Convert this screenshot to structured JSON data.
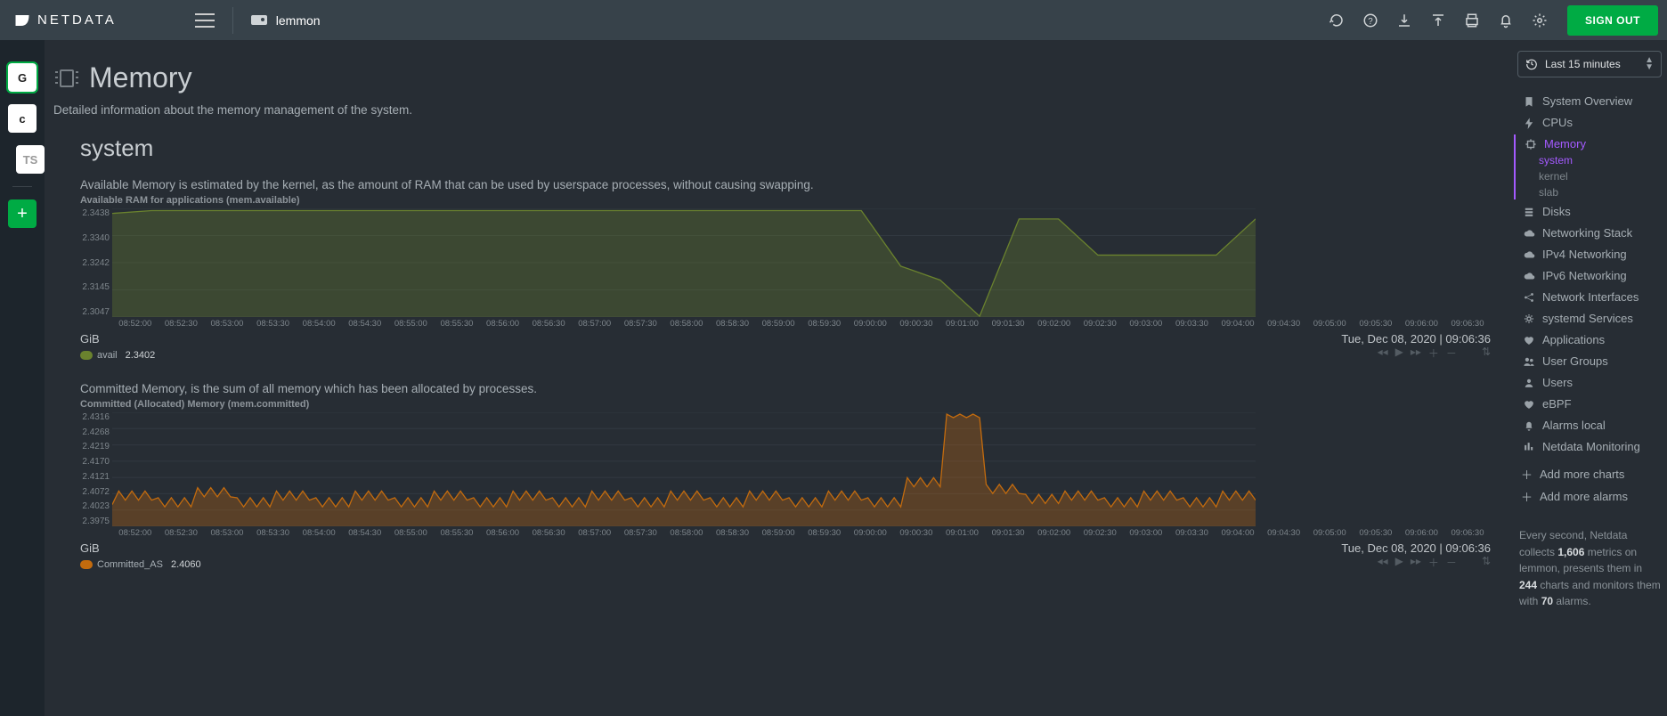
{
  "brand": "NETDATA",
  "host": "lemmon",
  "signout": "SIGN OUT",
  "rail": [
    "G",
    "c",
    "TS"
  ],
  "timerange": "Last 15 minutes",
  "page": {
    "title": "Memory",
    "subtitle": "Detailed information about the memory management of the system.",
    "section": "system"
  },
  "sidebar": {
    "items": [
      {
        "icon": "bookmark",
        "label": "System Overview"
      },
      {
        "icon": "bolt",
        "label": "CPUs"
      },
      {
        "icon": "chip",
        "label": "Memory",
        "active": true,
        "children": [
          {
            "label": "system",
            "active": true
          },
          {
            "label": "kernel"
          },
          {
            "label": "slab"
          }
        ]
      },
      {
        "icon": "disk",
        "label": "Disks"
      },
      {
        "icon": "cloud",
        "label": "Networking Stack"
      },
      {
        "icon": "cloud",
        "label": "IPv4 Networking"
      },
      {
        "icon": "cloud",
        "label": "IPv6 Networking"
      },
      {
        "icon": "share",
        "label": "Network Interfaces"
      },
      {
        "icon": "gears",
        "label": "systemd Services"
      },
      {
        "icon": "heart",
        "label": "Applications"
      },
      {
        "icon": "users",
        "label": "User Groups"
      },
      {
        "icon": "user",
        "label": "Users"
      },
      {
        "icon": "heart",
        "label": "eBPF"
      },
      {
        "icon": "bell",
        "label": "Alarms local"
      },
      {
        "icon": "bars",
        "label": "Netdata Monitoring"
      }
    ],
    "add_charts": "Add more charts",
    "add_alarms": "Add more alarms",
    "info": {
      "l1": "Every second, Netdata collects ",
      "metrics": "1,606",
      "l2": " metrics on lemmon, presents them in ",
      "charts": "244",
      "l3": " charts and monitors them with ",
      "alarms": "70",
      "l4": " alarms."
    }
  },
  "charts": [
    {
      "id": "avail",
      "desc": "Available Memory is estimated by the kernel, as the amount of RAM that can be used by userspace processes, without causing swapping.",
      "title": "Available RAM for applications (mem.available)",
      "unit": "GiB",
      "timestamp": "Tue, Dec 08, 2020 | 09:06:36",
      "legend": {
        "name": "avail",
        "value": "2.3402",
        "color": "#6a822e"
      },
      "color": "#6a822e"
    },
    {
      "id": "committed",
      "desc": "Committed Memory, is the sum of all memory which has been allocated by processes.",
      "title": "Committed (Allocated) Memory (mem.committed)",
      "unit": "GiB",
      "timestamp": "Tue, Dec 08, 2020 | 09:06:36",
      "legend": {
        "name": "Committed_AS",
        "value": "2.4060",
        "color": "#c36b0e"
      },
      "color": "#c36b0e"
    }
  ],
  "chart_data": [
    {
      "type": "area",
      "title": "Available RAM for applications (mem.available)",
      "xlabel": "",
      "ylabel": "GiB",
      "ylim": [
        2.3047,
        2.3438
      ],
      "yticks": [
        "2.3438",
        "2.3340",
        "2.3242",
        "2.3145",
        "2.3047"
      ],
      "x": [
        "08:52:00",
        "08:52:30",
        "08:53:00",
        "08:53:30",
        "08:54:00",
        "08:54:30",
        "08:55:00",
        "08:55:30",
        "08:56:00",
        "08:56:30",
        "08:57:00",
        "08:57:30",
        "08:58:00",
        "08:58:30",
        "08:59:00",
        "08:59:30",
        "09:00:00",
        "09:00:30",
        "09:01:00",
        "09:01:30",
        "09:02:00",
        "09:02:30",
        "09:03:00",
        "09:03:30",
        "09:04:00",
        "09:04:30",
        "09:05:00",
        "09:05:30",
        "09:06:00",
        "09:06:30"
      ],
      "series": [
        {
          "name": "avail",
          "values": [
            2.342,
            2.343,
            2.343,
            2.343,
            2.343,
            2.343,
            2.343,
            2.343,
            2.343,
            2.343,
            2.343,
            2.343,
            2.343,
            2.343,
            2.343,
            2.343,
            2.343,
            2.343,
            2.343,
            2.343,
            2.323,
            2.318,
            2.305,
            2.34,
            2.34,
            2.327,
            2.327,
            2.327,
            2.327,
            2.34
          ]
        }
      ]
    },
    {
      "type": "area",
      "title": "Committed (Allocated) Memory (mem.committed)",
      "xlabel": "",
      "ylabel": "GiB",
      "ylim": [
        2.3975,
        2.4316
      ],
      "yticks": [
        "2.4316",
        "2.4268",
        "2.4219",
        "2.4170",
        "2.4121",
        "2.4072",
        "2.4023",
        "2.3975"
      ],
      "x": [
        "08:52:00",
        "08:52:30",
        "08:53:00",
        "08:53:30",
        "08:54:00",
        "08:54:30",
        "08:55:00",
        "08:55:30",
        "08:56:00",
        "08:56:30",
        "08:57:00",
        "08:57:30",
        "08:58:00",
        "08:58:30",
        "08:59:00",
        "08:59:30",
        "09:00:00",
        "09:00:30",
        "09:01:00",
        "09:01:30",
        "09:02:00",
        "09:02:30",
        "09:03:00",
        "09:03:30",
        "09:04:00",
        "09:04:30",
        "09:05:00",
        "09:05:30",
        "09:06:00",
        "09:06:30"
      ],
      "series": [
        {
          "name": "Committed_AS",
          "values": [
            2.404,
            2.406,
            2.404,
            2.407,
            2.404,
            2.406,
            2.404,
            2.406,
            2.404,
            2.406,
            2.404,
            2.406,
            2.404,
            2.406,
            2.404,
            2.406,
            2.404,
            2.406,
            2.404,
            2.406,
            2.404,
            2.41,
            2.43,
            2.408,
            2.405,
            2.406,
            2.404,
            2.406,
            2.404,
            2.406
          ]
        }
      ]
    }
  ]
}
